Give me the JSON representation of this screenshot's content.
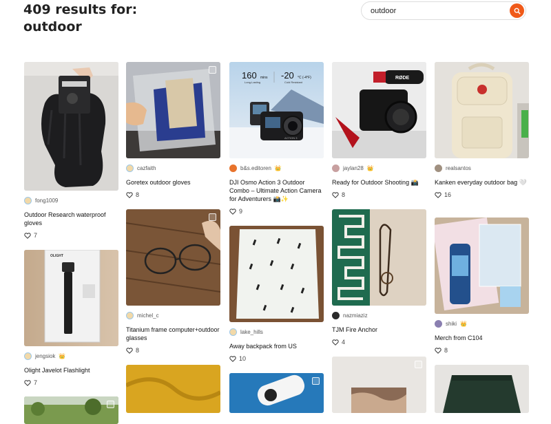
{
  "header": {
    "results_line": "409 results for:",
    "query_line": "outdoor"
  },
  "search": {
    "value": "outdoor",
    "button_icon": "search-icon"
  },
  "colors": {
    "accent": "#f05a19",
    "text": "#111111",
    "muted": "#555555"
  },
  "cards": [
    {
      "id": "c1",
      "author": "fong1009",
      "badge": false,
      "title": "Outdoor Research waterproof gloves",
      "likes": "7"
    },
    {
      "id": "c2",
      "author": "cazfaith",
      "badge": false,
      "title": "Goretex outdoor gloves",
      "likes": "8"
    },
    {
      "id": "c3",
      "author": "b&s.editoren",
      "badge": true,
      "title": "DJI Osmo Action 3 Outdoor Combo – Ultimate Action Camera for Adventurers 📸✨",
      "likes": "9",
      "image_text": {
        "spec1_value": "160",
        "spec1_unit": "mins",
        "spec1_label": "Long-Lasting",
        "spec2_value": "-20",
        "spec2_unit": "°C (-4°F)",
        "spec2_label": "Cold Resistant",
        "camera_label": "ACTION 3"
      }
    },
    {
      "id": "c4",
      "author": "jaylan28",
      "badge": true,
      "title": "Ready for Outdoor Shooting 📸",
      "likes": "8",
      "image_text": {
        "brand": "RØDE"
      }
    },
    {
      "id": "c5",
      "author": "realsantos",
      "badge": false,
      "title": "Kanken everyday outdoor bag 🤍",
      "likes": "16"
    },
    {
      "id": "c6",
      "author": "jengsiok",
      "badge": true,
      "title": "Olight Javelot Flashlight",
      "likes": "7",
      "image_text": {
        "brand": "OLIGHT"
      }
    },
    {
      "id": "c7",
      "author": "michel_c",
      "badge": false,
      "title": "Titanium frame computer+outdoor glasses",
      "likes": "8"
    },
    {
      "id": "c8",
      "author": "lake_hills",
      "badge": false,
      "title": "Away backpack from US",
      "likes": "10"
    },
    {
      "id": "c9",
      "author": "nazmiaziz",
      "badge": false,
      "title": "TJM Fire Anchor",
      "likes": "4"
    },
    {
      "id": "c10",
      "author": "shiki",
      "badge": true,
      "title": "Merch from C104",
      "likes": "8"
    }
  ],
  "icons": {
    "heart": "heart-icon",
    "crown": "crown-icon",
    "select": "select-checkbox-icon"
  }
}
